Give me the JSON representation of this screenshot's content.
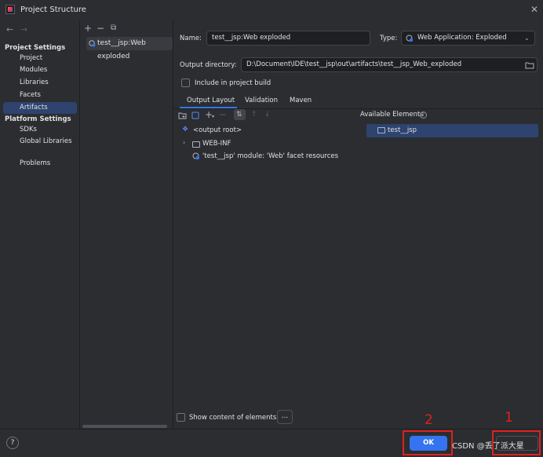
{
  "window": {
    "title": "Project Structure"
  },
  "nav": {
    "back": "←",
    "forward": "→",
    "project_settings": "Project Settings",
    "project_items": [
      "Project",
      "Modules",
      "Libraries",
      "Facets",
      "Artifacts"
    ],
    "platform_settings": "Platform Settings",
    "platform_items": [
      "SDKs",
      "Global Libraries"
    ],
    "problems": "Problems",
    "selected": "Artifacts"
  },
  "artifacts": {
    "add": "+",
    "remove": "−",
    "copy": "⧉",
    "items": [
      "test__jsp:Web exploded"
    ]
  },
  "form": {
    "name_label": "Name:",
    "name_value": "test__jsp:Web exploded",
    "type_label": "Type:",
    "type_value": "Web Application: Exploded",
    "output_label": "Output directory:",
    "output_value": "D:\\Document\\IDE\\test__jsp\\out\\artifacts\\test__jsp_Web_exploded",
    "include_label": "Include in project build"
  },
  "tabs": [
    "Output Layout",
    "Validation",
    "Maven"
  ],
  "layout_tree": {
    "root": "<output root>",
    "web_inf": "WEB-INF",
    "module": "'test__jsp' module: 'Web' facet resources"
  },
  "available": {
    "header": "Available Elements",
    "items": [
      "test__jsp"
    ]
  },
  "show_content_label": "Show content of elements",
  "ellipsis": "...",
  "buttons": {
    "ok": "OK",
    "help": "?"
  },
  "annotations": {
    "num1": "1",
    "num2": "2"
  },
  "watermark": "CSDN @丢了派大星",
  "colors": {
    "accent": "#3574f0",
    "annotation": "#e02020",
    "selection": "#2e436e"
  }
}
